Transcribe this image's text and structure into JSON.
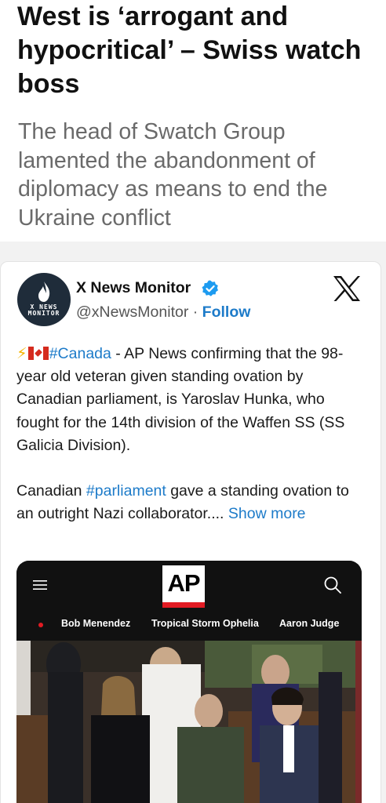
{
  "article": {
    "headline": "West is ‘arrogant and hypocritical’ – Swiss watch boss",
    "subheadline": "The head of Swatch Group lamented the abandonment of diplomacy as means to end the Ukraine conflict"
  },
  "tweet": {
    "author_name": "X News Monitor",
    "handle": "@xNewsMonitor",
    "separator": " · ",
    "follow_label": "Follow",
    "avatar_text": "X NEWS MONITOR",
    "paragraph1": {
      "emoji": "⚡",
      "hashtag": "#Canada",
      "text": " - AP News confirming that the 98-year old veteran given standing ovation by Canadian parliament, is Yaroslav Hunka, who fought for the 14th division of the Waffen SS (SS Galicia Division)."
    },
    "paragraph2": {
      "before": "Canadian ",
      "hashtag": "#parliament",
      "after": " gave a standing ovation to an outright Nazi collaborator.... ",
      "show_more": "Show more"
    }
  },
  "media": {
    "logo_text": "AP",
    "trending": [
      "Bob Menendez",
      "Tropical Storm Ophelia",
      "Aaron Judge"
    ]
  },
  "colors": {
    "link": "#1d7bc9",
    "verified": "#1d9bf0",
    "ap_red": "#e21b23"
  },
  "icons": [
    "verified-badge-icon",
    "x-logo-icon",
    "lightning-icon",
    "canada-flag-icon",
    "menu-icon",
    "search-icon"
  ]
}
